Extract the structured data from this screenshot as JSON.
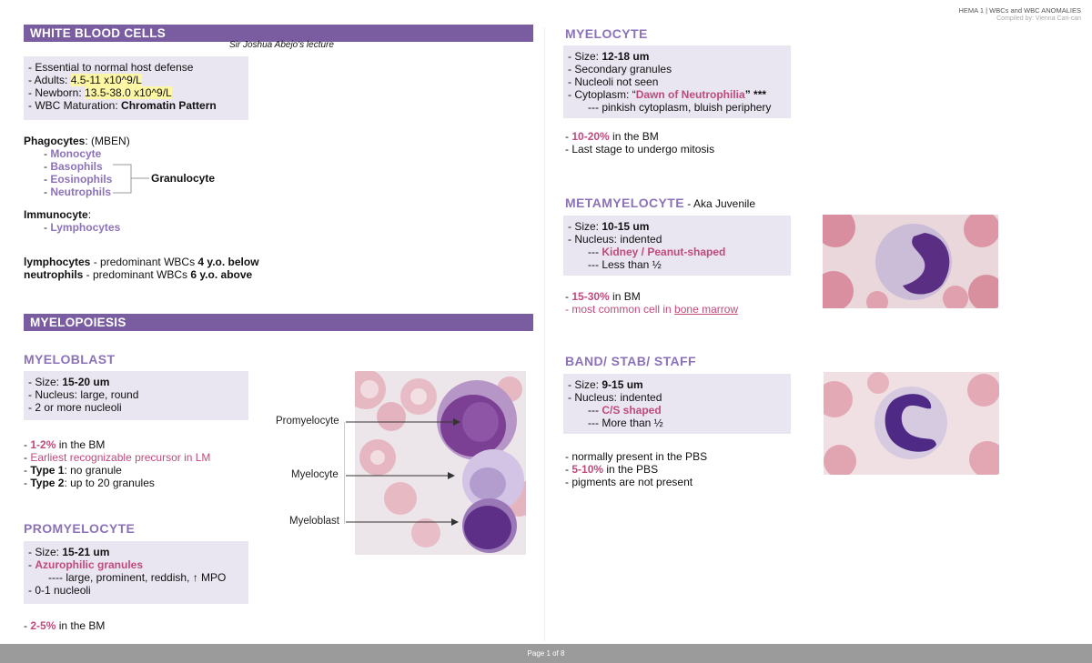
{
  "header": {
    "course": "HEMA 1 | WBCs and WBC ANOMALIES",
    "compiler": "Compiled by: Vienna Cari-can"
  },
  "footer": {
    "page": "Page 1 of 8"
  },
  "wbc": {
    "banner": "WHITE BLOOD CELLS",
    "lecture": "Sir Joshua Abejo's lecture",
    "box": {
      "l1": "- Essential to normal host defense",
      "adults_label": "- Adults: ",
      "adults_val": "4.5-11 x10^9/L",
      "newborn_label": "- Newborn: ",
      "newborn_val": "13.5-38.0 x10^9/L",
      "maturation_label": "- WBC Maturation: ",
      "maturation_val": "Chromatin Pattern"
    },
    "phagocytes_label": "Phagocytes",
    "phagocytes_rest": ": (MBEN)",
    "phagocytes": [
      "Monocyte",
      "Basophils",
      "Eosinophils",
      "Neutrophils"
    ],
    "granulocyte": "Granulocyte",
    "immunocyte_label": "Immunocyte",
    "immunocyte_rest": ":",
    "lymphocytes": "Lymphocytes",
    "lymph_word": "lymphocytes",
    "lymph_mid": " - predominant WBCs ",
    "lymph_age": "4 y.o. below",
    "neut_word": "neutrophils",
    "neut_mid": " - predominant WBCs ",
    "neut_age": "6 y.o. above"
  },
  "myelopoiesis": {
    "banner": "MYELOPOIESIS"
  },
  "myeloblast": {
    "title": "MYELOBLAST",
    "size_label": "- Size: ",
    "size_val": "15-20 um",
    "nucleus": "- Nucleus: large, round",
    "nucleoli": "- 2 or more nucleoli",
    "pct_dash": "- ",
    "pct": "1-2%",
    "pct_rest": " in the BM",
    "earliest": "Earliest recognizable precursor in LM",
    "type1_label": "Type 1",
    "type1_rest": ": no granule",
    "type2_label": "Type 2",
    "type2_rest": ": up to 20 granules"
  },
  "promyelocyte": {
    "title": "PROMYELOCYTE",
    "size_label": "- Size: ",
    "size_val": "15-21 um",
    "azuro": "Azurophilic granules",
    "granules_detail": "---- large, prominent, reddish, ↑ MPO",
    "nucleoli": "- 0-1 nucleoli",
    "pct": "2-5%",
    "pct_rest": " in the BM"
  },
  "figure": {
    "labels": [
      "Promyelocyte",
      "Myelocyte",
      "Myeloblast"
    ]
  },
  "myelocyte": {
    "title": "MYELOCYTE",
    "size_label": "- Size: ",
    "size_val": "12-18 um",
    "granules": "- Secondary granules",
    "nucleoli": "- Nucleoli not seen",
    "cyto_label": "- Cytoplasm: “",
    "cyto_val": "Dawn of Neutrophilia",
    "cyto_end": "” ***",
    "cyto_detail": "--- pinkish cytoplasm, bluish periphery",
    "pct": "10-20%",
    "pct_rest": " in the BM",
    "mitosis": "- Last stage to undergo mitosis"
  },
  "metamyelocyte": {
    "title": "METAMYELOCYTE",
    "aka": " - Aka Juvenile",
    "size_label": "- Size: ",
    "size_val": "10-15 um",
    "nucleus": "- Nucleus: indented",
    "kidney": "Kidney / Peanut-shaped",
    "less": "--- Less than ½",
    "pct": "15-30%",
    "pct_rest": " in BM",
    "common_pre": "most common cell in ",
    "common_link": "bone marrow"
  },
  "band": {
    "title": "BAND/ STAB/ STAFF",
    "size_label": "- Size: ",
    "size_val": "9-15 um",
    "nucleus": "- Nucleus: indented",
    "cs": "C/S shaped",
    "more": "--- More than ½",
    "normal": "- normally present in the PBS",
    "pct": "5-10%",
    "pct_rest": " in the PBS",
    "pigments": "- pigments are not present"
  },
  "colors": {
    "banner": "#7a5da0",
    "title": "#8c72b8",
    "box": "#e9e5f1",
    "pink": "#c04a7c",
    "highlight": "#fdf6a5"
  }
}
